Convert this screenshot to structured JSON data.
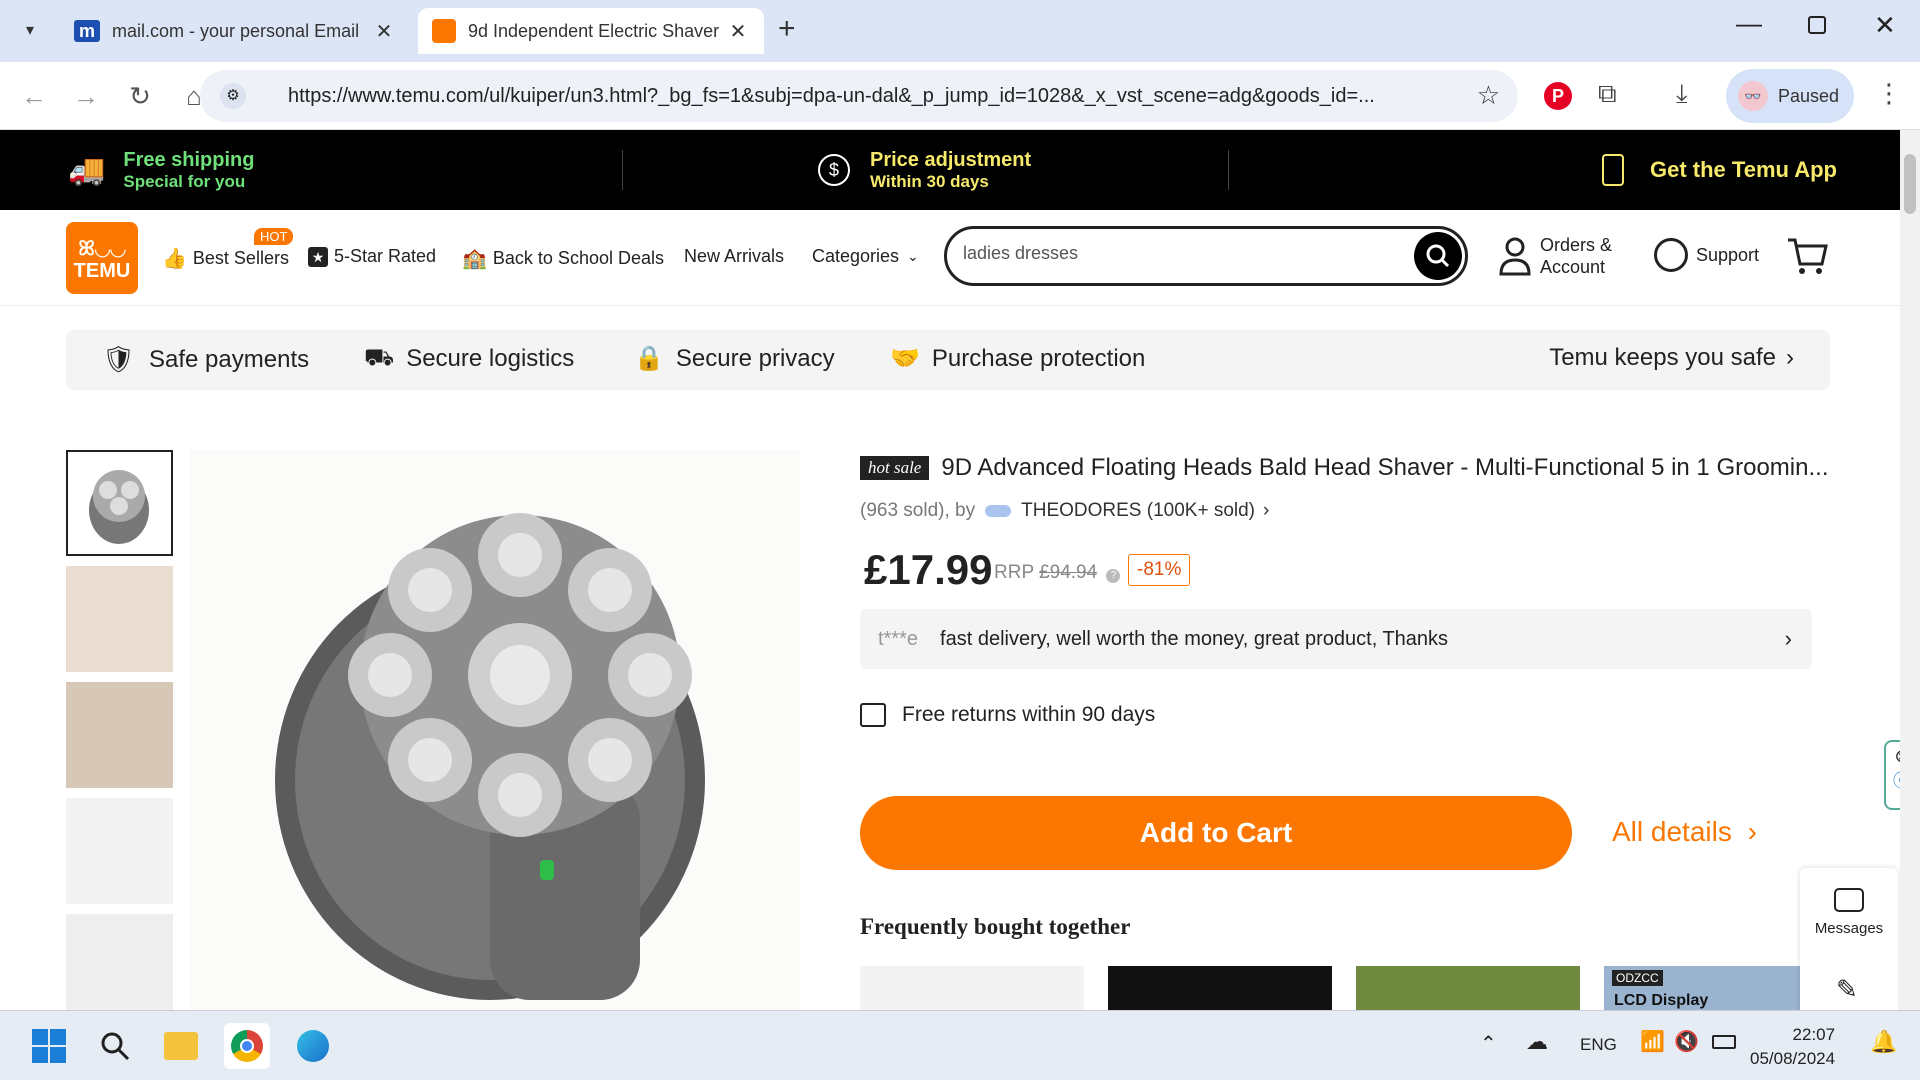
{
  "browser": {
    "tabs": [
      {
        "title": "mail.com - your personal Email",
        "favicon": "mail-m-icon",
        "active": false
      },
      {
        "title": "9d Independent Electric Shaver",
        "favicon": "temu-icon",
        "active": true
      }
    ],
    "url": "https://www.temu.com/ul/kuiper/un3.html?_bg_fs=1&subj=dpa-un-dal&_p_jump_id=1028&_x_vst_scene=adg&goods_id=...",
    "profile_label": "Paused"
  },
  "promo": {
    "shipping_title": "Free shipping",
    "shipping_sub": "Special for you",
    "price_title": "Price adjustment",
    "price_sub": "Within 30 days",
    "app_label": "Get the Temu App"
  },
  "header": {
    "logo_line1": "ꕤ◡◡",
    "logo_line2": "TEMU",
    "hot_badge": "HOT",
    "nav": {
      "best_sellers": "Best Sellers",
      "five_star": "5-Star Rated",
      "back_to_school": "Back to School Deals",
      "new_arrivals": "New Arrivals",
      "categories": "Categories"
    },
    "search_value": "ladies dresses",
    "orders_line1": "Orders &",
    "orders_line2": "Account",
    "support": "Support"
  },
  "safety": {
    "safe_payments": "Safe payments",
    "secure_logistics": "Secure logistics",
    "secure_privacy": "Secure privacy",
    "purchase_protection": "Purchase protection",
    "keeps_safe": "Temu keeps you safe"
  },
  "product": {
    "badge": "hot sale",
    "title": "9D Advanced Floating Heads Bald Head Shaver - Multi-Functional 5 in 1 Groomin...",
    "sold": "(963 sold), by",
    "seller": "THEODORES (100K+ sold)",
    "price": "£17.99",
    "rrp_label": "RRP",
    "rrp_value": "£94.94",
    "discount": "-81%",
    "review_user": "t***e",
    "review_text": "fast delivery, well worth the money, great product, Thanks",
    "returns": "Free returns within 90 days",
    "add_to_cart": "Add to Cart",
    "all_details": "All details",
    "fbt_heading": "Frequently bought together",
    "fbt_brand": "ODZCC",
    "fbt_caption": "LCD Display"
  },
  "floating": {
    "messages": "Messages"
  },
  "taskbar": {
    "lang": "ENG",
    "time": "22:07",
    "date": "05/08/2024"
  },
  "colors": {
    "brand_orange": "#fb7701",
    "promo_green": "#6fe07a",
    "promo_yellow": "#f7e96a"
  }
}
